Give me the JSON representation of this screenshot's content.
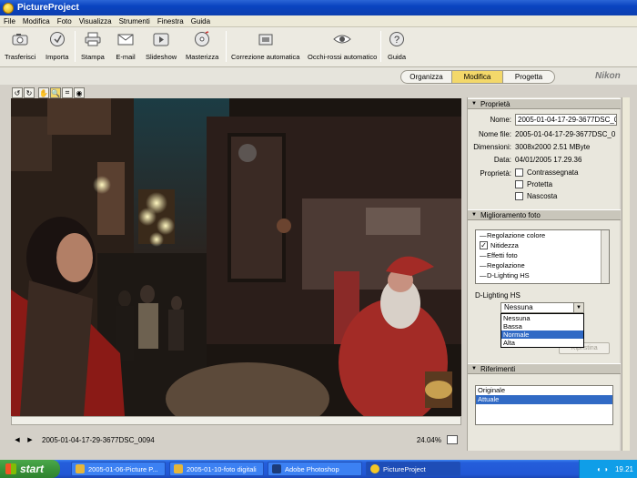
{
  "window": {
    "title": "PictureProject"
  },
  "menu": [
    "File",
    "Modifica",
    "Foto",
    "Visualizza",
    "Strumenti",
    "Finestra",
    "Guida"
  ],
  "toolbar": [
    {
      "label": "Trasferisci",
      "icon": "camera-icon"
    },
    {
      "label": "Importa",
      "icon": "import-icon"
    },
    {
      "label": "Stampa",
      "icon": "printer-icon"
    },
    {
      "label": "E-mail",
      "icon": "mail-icon"
    },
    {
      "label": "Slideshow",
      "icon": "slideshow-icon"
    },
    {
      "label": "Masterizza",
      "icon": "burn-disc-icon"
    },
    {
      "label": "Correzione automatica",
      "icon": "auto-correct-icon"
    },
    {
      "label": "Occhi-rossi automatico",
      "icon": "red-eye-icon"
    },
    {
      "label": "Guida",
      "icon": "help-icon"
    }
  ],
  "modes": {
    "organizza": "Organizza",
    "modifica": "Modifica",
    "progetta": "Progetta",
    "active": "Modifica"
  },
  "brand": "Nikon",
  "viewer": {
    "filename": "2005-01-04-17-29-3677DSC_0094",
    "zoom": "24.04%"
  },
  "properties": {
    "heading": "Proprietà",
    "name_label": "Nome:",
    "name_value": "2005-01-04-17-29-3677DSC_0",
    "file_label": "Nome file:",
    "file_value": "2005-01-04-17-29-3677DSC_0",
    "dim_label": "Dimensioni:",
    "dim_value": "3008x2000  2.51 MByte",
    "date_label": "Data:",
    "date_value": "04/01/2005 17.29.36",
    "props_label": "Proprietà:",
    "checks": [
      {
        "label": "Contrassegnata",
        "checked": false
      },
      {
        "label": "Protetta",
        "checked": false
      },
      {
        "label": "Nascosta",
        "checked": false
      }
    ]
  },
  "enhancement": {
    "heading": "Miglioramento foto",
    "items": [
      {
        "label": "Regolazione colore",
        "checked": null
      },
      {
        "label": "Nitidezza",
        "checked": true
      },
      {
        "label": "Effetti foto",
        "checked": null
      },
      {
        "label": "Regolazione",
        "checked": null
      },
      {
        "label": "D-Lighting HS",
        "checked": null
      }
    ],
    "dlighting_label": "D-Lighting HS",
    "dlighting_value": "Nessuna",
    "dlighting_options": [
      "Nessuna",
      "Bassa",
      "Normale",
      "Alta"
    ],
    "dlighting_highlight": "Normale",
    "reset_label": "Ripristina"
  },
  "references": {
    "heading": "Riferimenti",
    "items": [
      "Originale",
      "Attuale"
    ],
    "selected": "Attuale"
  },
  "taskbar": {
    "start": "start",
    "tasks": [
      {
        "label": "2005-01-06-Picture P...",
        "color": "#e5b63a"
      },
      {
        "label": "2005-01-10-foto digitali",
        "color": "#e5b63a"
      },
      {
        "label": "Adobe Photoshop",
        "color": "#1c3c7a"
      },
      {
        "label": "PictureProject",
        "color": "#f3c726"
      }
    ],
    "active_task": "PictureProject",
    "clock": "19.21"
  }
}
